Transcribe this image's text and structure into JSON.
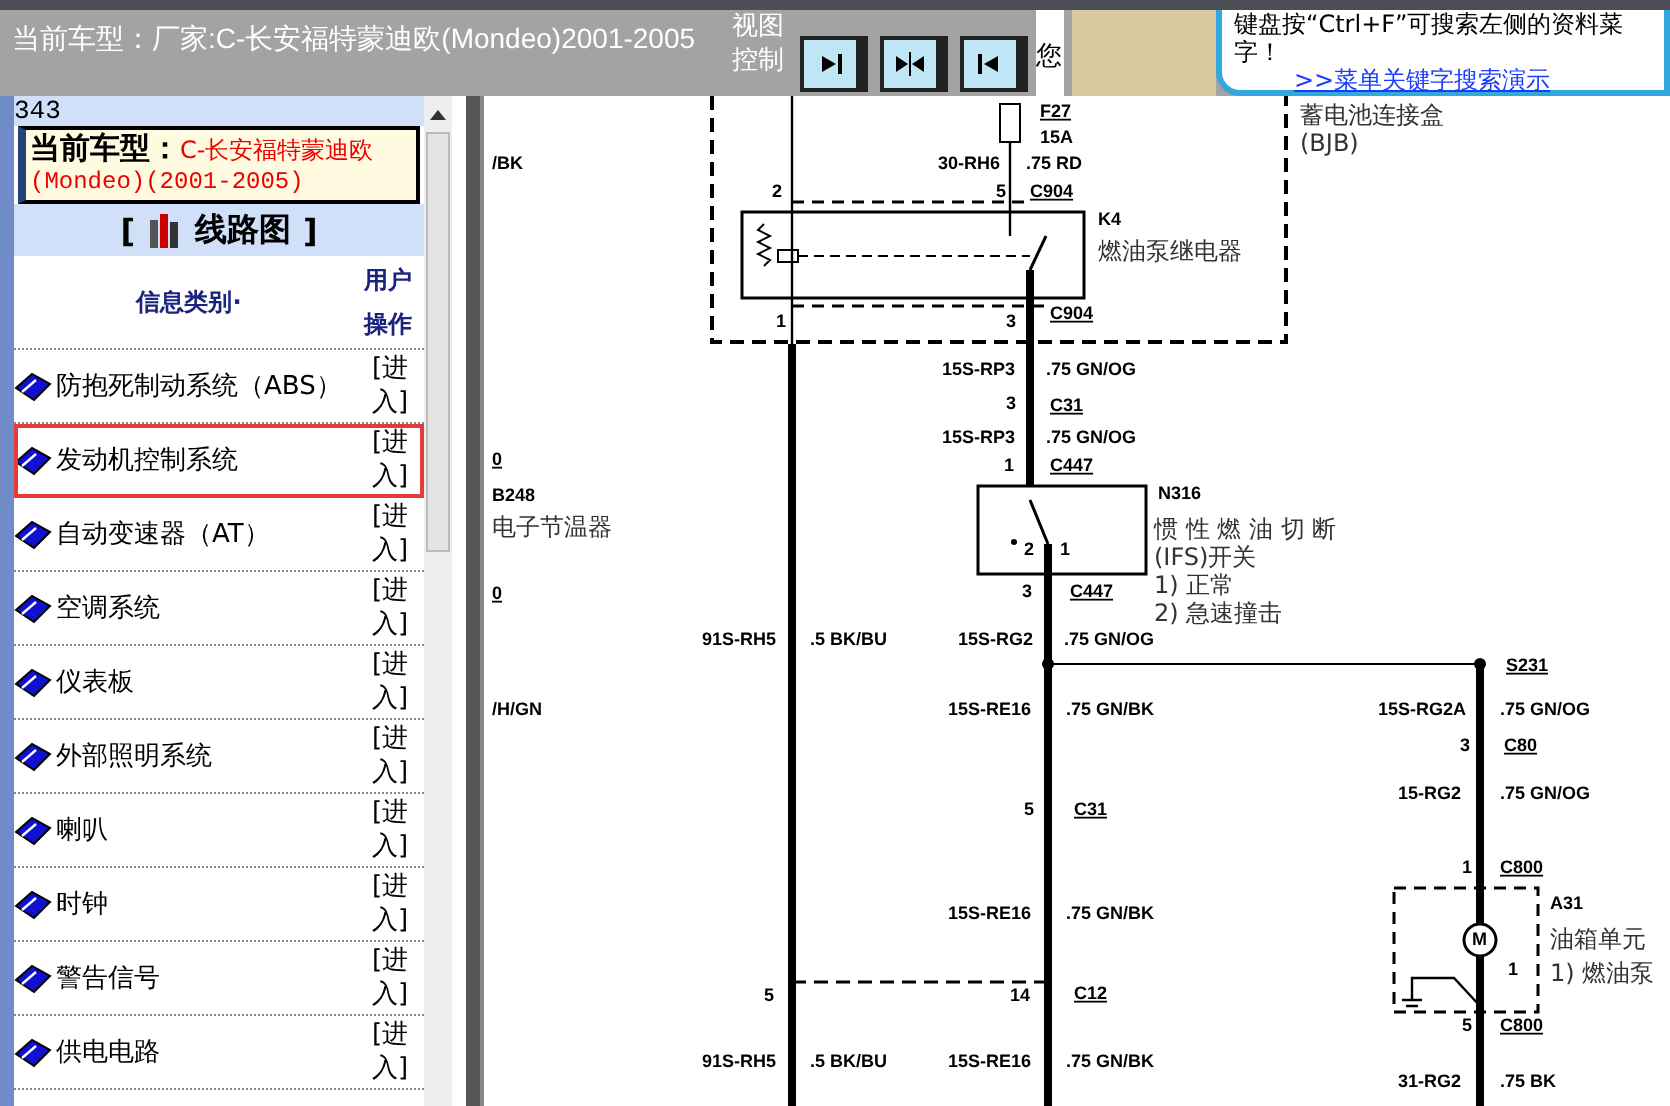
{
  "title_bar": {
    "title": "当前车型：厂家:C-长安福特蒙迪欧(Mondeo)2001-2005",
    "view_label": "视图控制",
    "cut_label": "您"
  },
  "help_panel": {
    "line_1": "键盘按“Ctrl+F”可搜索左侧的资料菜",
    "line_2": "字！",
    "link": ">>菜单关键字搜索演示"
  },
  "sidebar": {
    "record_count": "343",
    "car_label": "当前车型：",
    "car_model": "C-长安福特蒙迪欧",
    "car_years": "(Mondeo)(2001-2005)",
    "open_bracket": "[",
    "section_title": "线路图",
    "close_bracket": "]",
    "columns": [
      "信息类别·",
      "用户操作"
    ],
    "items": [
      {
        "label": "防抱死制动系统（ABS）",
        "action": "[进入]",
        "selected": false
      },
      {
        "label": "发动机控制系统",
        "action": "[进入]",
        "selected": true
      },
      {
        "label": "自动变速器（AT）",
        "action": "[进入]",
        "selected": false
      },
      {
        "label": "空调系统",
        "action": "[进入]",
        "selected": false
      },
      {
        "label": "仪表板",
        "action": "[进入]",
        "selected": false
      },
      {
        "label": "外部照明系统",
        "action": "[进入]",
        "selected": false
      },
      {
        "label": "喇叭",
        "action": "[进入]",
        "selected": false
      },
      {
        "label": "时钟",
        "action": "[进入]",
        "selected": false
      },
      {
        "label": "警告信号",
        "action": "[进入]",
        "selected": false
      },
      {
        "label": "供电电路",
        "action": "[进入]",
        "selected": false
      }
    ]
  },
  "diagram": {
    "labels": [
      {
        "text": "蓄电池连接盒",
        "kind": "desc"
      },
      {
        "text": "(BJB)",
        "kind": "desc"
      },
      {
        "text": "F27",
        "kind": "connector"
      },
      {
        "text": "15A",
        "kind": "code"
      },
      {
        "text": "/BK",
        "kind": "code"
      },
      {
        "text": "30-RH6",
        "kind": "code"
      },
      {
        "text": ".75 RD",
        "kind": "code"
      },
      {
        "text": "2",
        "kind": "code"
      },
      {
        "text": "5",
        "kind": "code"
      },
      {
        "text": "C904",
        "kind": "connector"
      },
      {
        "text": "K4",
        "kind": "code"
      },
      {
        "text": "燃油泵继电器",
        "kind": "desc"
      },
      {
        "text": "1",
        "kind": "code"
      },
      {
        "text": "3",
        "kind": "code"
      },
      {
        "text": "C904",
        "kind": "connector"
      },
      {
        "text": "15S-RP3",
        "kind": "code"
      },
      {
        "text": ".75 GN/OG",
        "kind": "code"
      },
      {
        "text": "3",
        "kind": "code"
      },
      {
        "text": "C31",
        "kind": "connector"
      },
      {
        "text": "15S-RP3",
        "kind": "code"
      },
      {
        "text": ".75 GN/OG",
        "kind": "code"
      },
      {
        "text": "0",
        "kind": "connector"
      },
      {
        "text": "1",
        "kind": "code"
      },
      {
        "text": "C447",
        "kind": "connector"
      },
      {
        "text": "B248",
        "kind": "code"
      },
      {
        "text": "N316",
        "kind": "code"
      },
      {
        "text": "电子节温器",
        "kind": "desc"
      },
      {
        "text": "惯 性 燃 油 切 断",
        "kind": "desc"
      },
      {
        "text": "2",
        "kind": "code"
      },
      {
        "text": "1",
        "kind": "code"
      },
      {
        "text": "(IFS)开关",
        "kind": "desc"
      },
      {
        "text": "0",
        "kind": "connector"
      },
      {
        "text": "3",
        "kind": "code"
      },
      {
        "text": "C447",
        "kind": "connector"
      },
      {
        "text": "1) 正常",
        "kind": "desc"
      },
      {
        "text": "2) 急速撞击",
        "kind": "desc"
      },
      {
        "text": "91S-RH5",
        "kind": "code"
      },
      {
        "text": ".5 BK/BU",
        "kind": "code"
      },
      {
        "text": "15S-RG2",
        "kind": "code"
      },
      {
        "text": ".75 GN/OG",
        "kind": "code"
      },
      {
        "text": "S231",
        "kind": "connector"
      },
      {
        "text": "/H/GN",
        "kind": "code"
      },
      {
        "text": "15S-RE16",
        "kind": "code"
      },
      {
        "text": ".75 GN/BK",
        "kind": "code"
      },
      {
        "text": "15S-RG2A",
        "kind": "code"
      },
      {
        "text": ".75 GN/OG",
        "kind": "code"
      },
      {
        "text": "3",
        "kind": "code"
      },
      {
        "text": "C80",
        "kind": "connector"
      },
      {
        "text": "15-RG2",
        "kind": "code"
      },
      {
        "text": ".75 GN/OG",
        "kind": "code"
      },
      {
        "text": "5",
        "kind": "code"
      },
      {
        "text": "C31",
        "kind": "connector"
      },
      {
        "text": "1",
        "kind": "code"
      },
      {
        "text": "C800",
        "kind": "connector"
      },
      {
        "text": "A31",
        "kind": "code"
      },
      {
        "text": "15S-RE16",
        "kind": "code"
      },
      {
        "text": ".75 GN/BK",
        "kind": "code"
      },
      {
        "text": "油箱单元",
        "kind": "desc"
      },
      {
        "text": "M",
        "kind": "code"
      },
      {
        "text": "1",
        "kind": "code"
      },
      {
        "text": "1) 燃油泵",
        "kind": "desc"
      },
      {
        "text": "5",
        "kind": "code"
      },
      {
        "text": "14",
        "kind": "code"
      },
      {
        "text": "C12",
        "kind": "connector"
      },
      {
        "text": "5",
        "kind": "code"
      },
      {
        "text": "C800",
        "kind": "connector"
      },
      {
        "text": "91S-RH5",
        "kind": "code"
      },
      {
        "text": ".5 BK/BU",
        "kind": "code"
      },
      {
        "text": "15S-RE16",
        "kind": "code"
      },
      {
        "text": ".75 GN/BK",
        "kind": "code"
      },
      {
        "text": "31-RG2",
        "kind": "code"
      },
      {
        "text": ".75 BK",
        "kind": "code"
      }
    ]
  }
}
